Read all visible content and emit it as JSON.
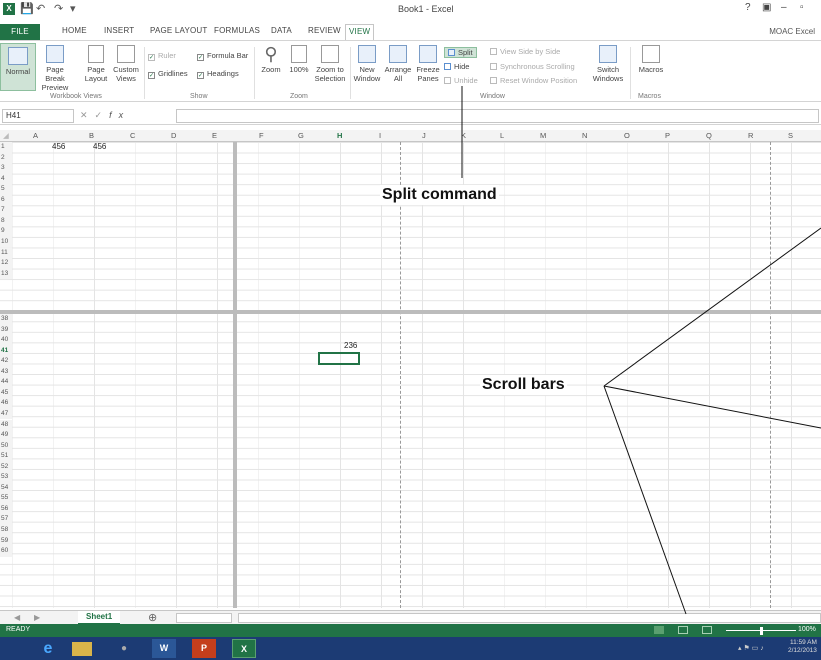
{
  "window": {
    "title": "Book1 - Excel",
    "app_icon": "X",
    "account": "MOAC Excel",
    "controls": [
      "?",
      "▣",
      "–",
      "▫"
    ]
  },
  "tabs": [
    "FILE",
    "HOME",
    "INSERT",
    "PAGE LAYOUT",
    "FORMULAS",
    "DATA",
    "REVIEW",
    "VIEW"
  ],
  "active_tab": "VIEW",
  "ribbon": {
    "workbook_views": {
      "normal": "Normal",
      "page_break_1": "Page Break",
      "page_break_2": "Preview",
      "page_layout_1": "Page",
      "page_layout_2": "Layout",
      "custom_1": "Custom",
      "custom_2": "Views",
      "label": "Workbook Views"
    },
    "show": {
      "ruler": "Ruler",
      "formula_bar": "Formula Bar",
      "gridlines": "Gridlines",
      "headings": "Headings",
      "label": "Show"
    },
    "zoom": {
      "zoom": "Zoom",
      "zoom100": "100%",
      "zoom_sel_1": "Zoom to",
      "zoom_sel_2": "Selection",
      "label": "Zoom"
    },
    "window": {
      "new_1": "New",
      "new_2": "Window",
      "arrange_1": "Arrange",
      "arrange_2": "All",
      "freeze_1": "Freeze",
      "freeze_2": "Panes",
      "split": "Split",
      "hide": "Hide",
      "unhide": "Unhide",
      "side_by_side": "View Side by Side",
      "sync_scroll": "Synchronous Scrolling",
      "reset_pos": "Reset Window Position",
      "switch_1": "Switch",
      "switch_2": "Windows",
      "label": "Window"
    },
    "macros": {
      "macros": "Macros",
      "label": "Macros"
    }
  },
  "formula_bar": {
    "name_box": "H41",
    "fx": "fx",
    "value": ""
  },
  "columns": [
    "A",
    "B",
    "C",
    "D",
    "E",
    "F",
    "G",
    "H",
    "I",
    "J",
    "K",
    "L",
    "M",
    "N",
    "O",
    "P",
    "Q",
    "R",
    "S"
  ],
  "rows_top": [
    "1",
    "2",
    "3",
    "4",
    "5",
    "6",
    "7",
    "8",
    "9",
    "10",
    "11",
    "12",
    "13"
  ],
  "rows_bottom": [
    "38",
    "39",
    "40",
    "41",
    "42",
    "43",
    "44",
    "45",
    "46",
    "47",
    "48",
    "49",
    "50",
    "51",
    "52",
    "53",
    "54",
    "55",
    "56",
    "57",
    "58",
    "59",
    "60"
  ],
  "cells": {
    "a1": "456",
    "b1": "456",
    "h40": "236"
  },
  "sheet_tab": "Sheet1",
  "status": {
    "ready": "READY",
    "zoom": "100%",
    "time": "11:59 AM",
    "date": "2/12/2013"
  },
  "annotations": {
    "split_command": "Split command",
    "scroll_bars": "Scroll bars"
  },
  "colors": {
    "excel_green": "#217346",
    "taskbar": "#1c3b74"
  }
}
